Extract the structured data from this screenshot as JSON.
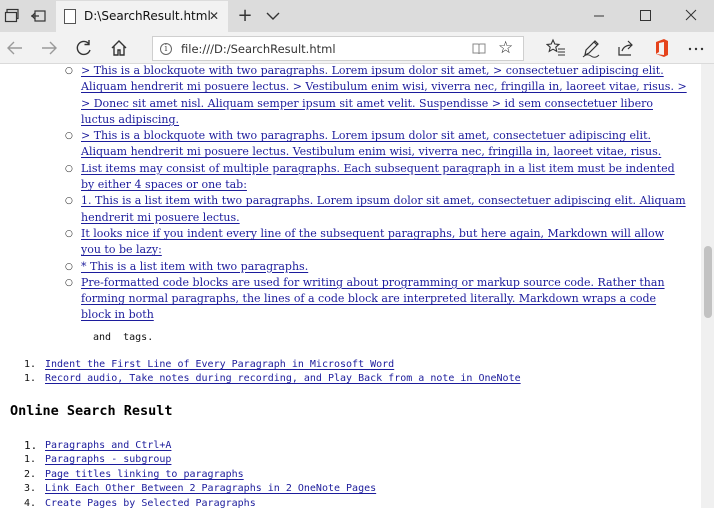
{
  "browser": {
    "tab_title": "D:\\SearchResult.html",
    "url": "file:///D:/SearchResult.html",
    "new_tab_label": "+"
  },
  "content": {
    "blockquote_items": [
      {
        "text": "> This is a blockquote with two paragraphs. Lorem ipsum dolor sit amet, > consectetuer adipiscing elit. Aliquam hendrerit mi posuere lectus. > Vestibulum enim wisi, viverra nec, fringilla in, laoreet vitae, risus. > > Donec sit amet nisl. Aliquam semper ipsum sit amet velit. Suspendisse > id sem consectetuer libero luctus adipiscing."
      },
      {
        "text": "> This is a blockquote with two paragraphs. Lorem ipsum dolor sit amet, consectetuer adipiscing elit. Aliquam hendrerit mi posuere lectus. Vestibulum enim wisi, viverra nec, fringilla in, laoreet vitae, risus."
      },
      {
        "text": "List items may consist of multiple paragraphs. Each subsequent paragraph in a list item must be indented by either 4 spaces or one tab:"
      },
      {
        "text": "1. This is a list item with two paragraphs. Lorem ipsum dolor sit amet, consectetuer adipiscing elit. Aliquam hendrerit mi posuere lectus."
      },
      {
        "text": "It looks nice if you indent every line of the subsequent paragraphs, but here again, Markdown will allow you to be lazy:"
      },
      {
        "text": "* This is a list item with two paragraphs."
      },
      {
        "text": "Pre-formatted code blocks are used for writing about programming or markup source code. Rather than forming normal paragraphs, the lines of a code block are interpreted literally. Markdown wraps a code block in both"
      }
    ],
    "trailing_text": " and  tags.",
    "first_ordered_list": [
      {
        "number": "1.",
        "text": "Indent the First Line of Every Paragraph in Microsoft Word"
      },
      {
        "number": "1.",
        "text": "Record audio, Take notes during recording, and Play Back from a note in OneNote"
      }
    ],
    "section_heading": "Online Search Result",
    "search_results": [
      {
        "number": "1.",
        "text": "Paragraphs and Ctrl+A"
      },
      {
        "number": "1.",
        "text": "Paragraphs - subgroup"
      },
      {
        "number": "2.",
        "text": "Page titles linking to paragraphs"
      },
      {
        "number": "3.",
        "text": "Link Each Other Between 2 Paragraphs in 2 OneNote Pages"
      },
      {
        "number": "4.",
        "text": "Create Pages by Selected Paragraphs"
      }
    ]
  },
  "icons": {
    "tab_actions": "tab-actions-icon",
    "set_aside": "set-aside-tabs-icon",
    "tab_page": "page-icon",
    "close": "close-icon",
    "new_tab": "plus-icon",
    "tab_menu": "chevron-down-icon",
    "minimize": "minimize-icon",
    "maximize": "maximize-icon",
    "window_close": "window-close-icon",
    "back": "back-arrow-icon",
    "forward": "forward-arrow-icon",
    "refresh": "refresh-icon",
    "home": "home-icon",
    "info": "info-icon",
    "reading_view": "reading-view-icon",
    "favorite": "star-icon",
    "favorites_hub": "favorites-list-icon",
    "web_note": "pen-icon",
    "share": "share-icon",
    "office": "office-icon",
    "more": "more-icon"
  },
  "colors": {
    "link": "#1c1c9c",
    "title_bar": "#dcdcdc",
    "toolbar": "#f2f2f2",
    "office_red": "#e5431c"
  }
}
